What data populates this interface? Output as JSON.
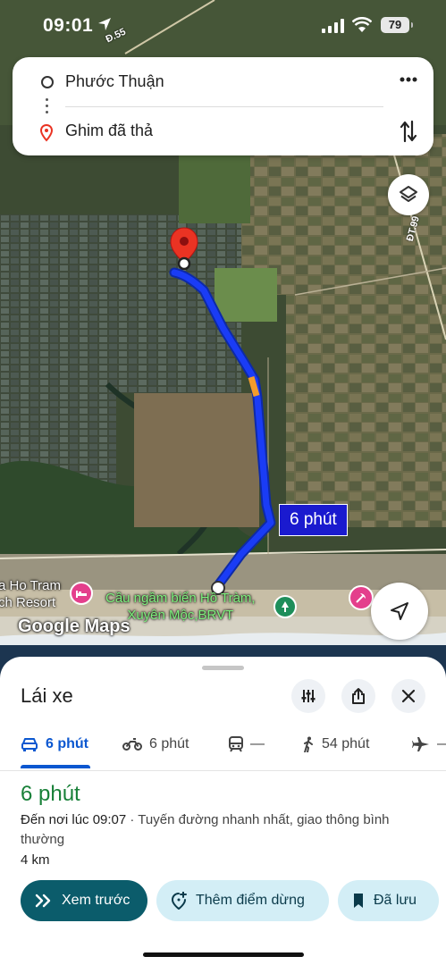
{
  "status_bar": {
    "time": "09:01",
    "battery": "79"
  },
  "directions": {
    "origin": "Phước Thuận",
    "destination": "Ghim đã thả"
  },
  "map": {
    "route_time_badge": "6 phút",
    "labels": {
      "resort": "a Ho Tram\nch Resort",
      "bridge": "Cầu ngầm biển Hồ Tràm,\nXuyên Mộc,BRVT",
      "logo": "Google Maps",
      "road1": "Đ.55",
      "road2": "ĐT.99"
    },
    "route_color": "#1a3cf5",
    "traffic_slow_color": "#f39c2b"
  },
  "sheet": {
    "title": "Lái xe",
    "modes": [
      {
        "icon": "car-icon",
        "label": "6 phút"
      },
      {
        "icon": "motorbike-icon",
        "label": "6 phút"
      },
      {
        "icon": "transit-icon",
        "label": "—"
      },
      {
        "icon": "walk-icon",
        "label": "54 phút"
      },
      {
        "icon": "flight-icon",
        "label": "—"
      }
    ],
    "duration": "6 phút",
    "eta": "Đến nơi lúc 09:07",
    "route_desc": " · Tuyến đường nhanh nhất, giao thông bình thường",
    "distance": "4 km",
    "actions": {
      "preview": "Xem trước",
      "add_stop": "Thêm điểm dừng",
      "saved": "Đã lưu"
    }
  },
  "colors": {
    "accent": "#0b57d0",
    "duration_green": "#188038",
    "primary_pill": "#0b5c6b",
    "secondary_pill": "#d3eef6"
  }
}
